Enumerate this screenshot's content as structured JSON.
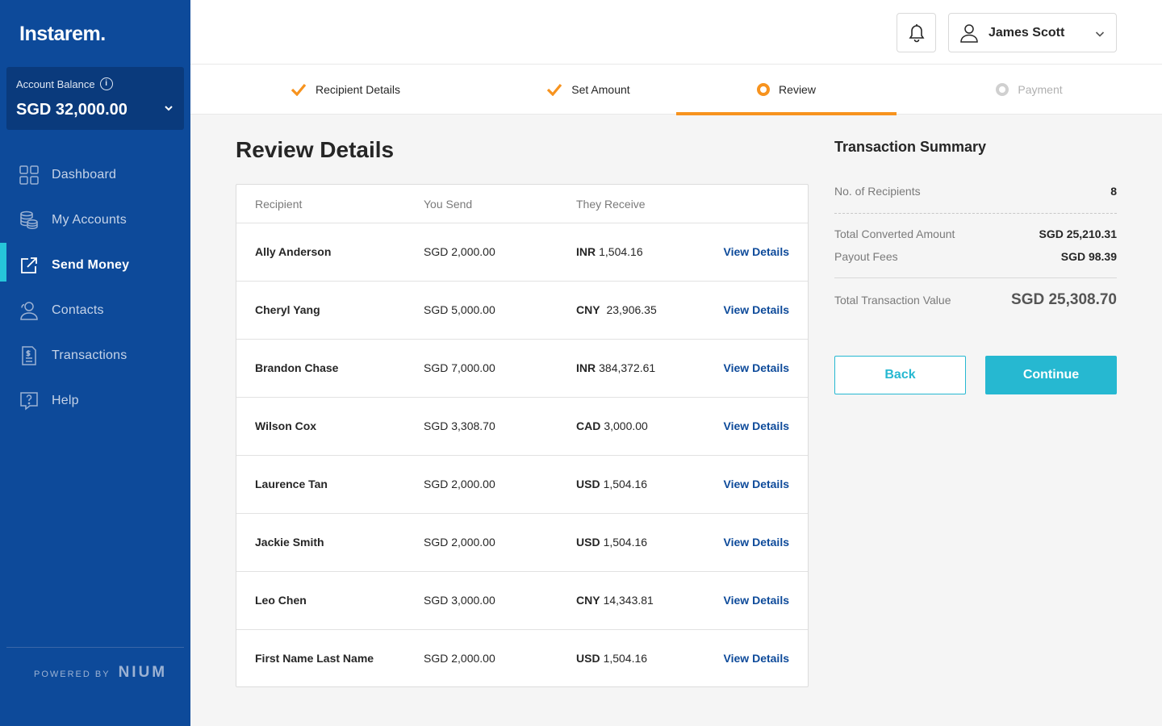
{
  "brand": {
    "logo": "Instarem."
  },
  "balance": {
    "label": "Account Balance",
    "value": "SGD 32,000.00"
  },
  "nav": [
    {
      "label": "Dashboard",
      "icon": "grid-icon",
      "active": false
    },
    {
      "label": "My Accounts",
      "icon": "coins-icon",
      "active": false
    },
    {
      "label": "Send Money",
      "icon": "send-icon",
      "active": true
    },
    {
      "label": "Contacts",
      "icon": "contacts-icon",
      "active": false
    },
    {
      "label": "Transactions",
      "icon": "receipt-icon",
      "active": false
    },
    {
      "label": "Help",
      "icon": "help-icon",
      "active": false
    }
  ],
  "footer": {
    "powered_label": "POWERED BY",
    "powered_brand": "NIUM"
  },
  "header": {
    "user_name": "James Scott"
  },
  "steps": [
    {
      "label": "Recipient Details",
      "status": "done"
    },
    {
      "label": "Set Amount",
      "status": "done"
    },
    {
      "label": "Review",
      "status": "current"
    },
    {
      "label": "Payment",
      "status": "pending"
    }
  ],
  "page": {
    "title": "Review Details"
  },
  "table": {
    "headers": {
      "recipient": "Recipient",
      "send": "You Send",
      "receive": "They Receive"
    },
    "link_label": "View Details",
    "rows": [
      {
        "name": "Ally Anderson",
        "send": "SGD 2,000.00",
        "currency": "INR",
        "amount": "1,504.16"
      },
      {
        "name": "Cheryl Yang",
        "send": "SGD 5,000.00",
        "currency": "CNY",
        "amount": " 23,906.35"
      },
      {
        "name": "Brandon Chase",
        "send": "SGD 7,000.00",
        "currency": "INR",
        "amount": "384,372.61"
      },
      {
        "name": "Wilson Cox",
        "send": "SGD 3,308.70",
        "currency": "CAD",
        "amount": "3,000.00"
      },
      {
        "name": "Laurence Tan",
        "send": "SGD 2,000.00",
        "currency": "USD",
        "amount": "1,504.16"
      },
      {
        "name": "Jackie Smith",
        "send": "SGD 2,000.00",
        "currency": "USD",
        "amount": "1,504.16"
      },
      {
        "name": "Leo Chen",
        "send": "SGD 3,000.00",
        "currency": "CNY",
        "amount": "14,343.81"
      },
      {
        "name": "First Name Last Name",
        "send": "SGD 2,000.00",
        "currency": "USD",
        "amount": "1,504.16"
      }
    ]
  },
  "summary": {
    "title": "Transaction Summary",
    "recipients_label": "No. of Recipients",
    "recipients_value": "8",
    "converted_label": "Total Converted Amount",
    "converted_value": "SGD 25,210.31",
    "fees_label": "Payout Fees",
    "fees_value": "SGD 98.39",
    "total_label": "Total Transaction Value",
    "total_value": "SGD 25,308.70"
  },
  "actions": {
    "back_label": "Back",
    "continue_label": "Continue"
  },
  "colors": {
    "sidebar": "#0d4a9a",
    "accent": "#26b8d1",
    "step_active": "#f7931e",
    "link": "#0d4a9a"
  }
}
